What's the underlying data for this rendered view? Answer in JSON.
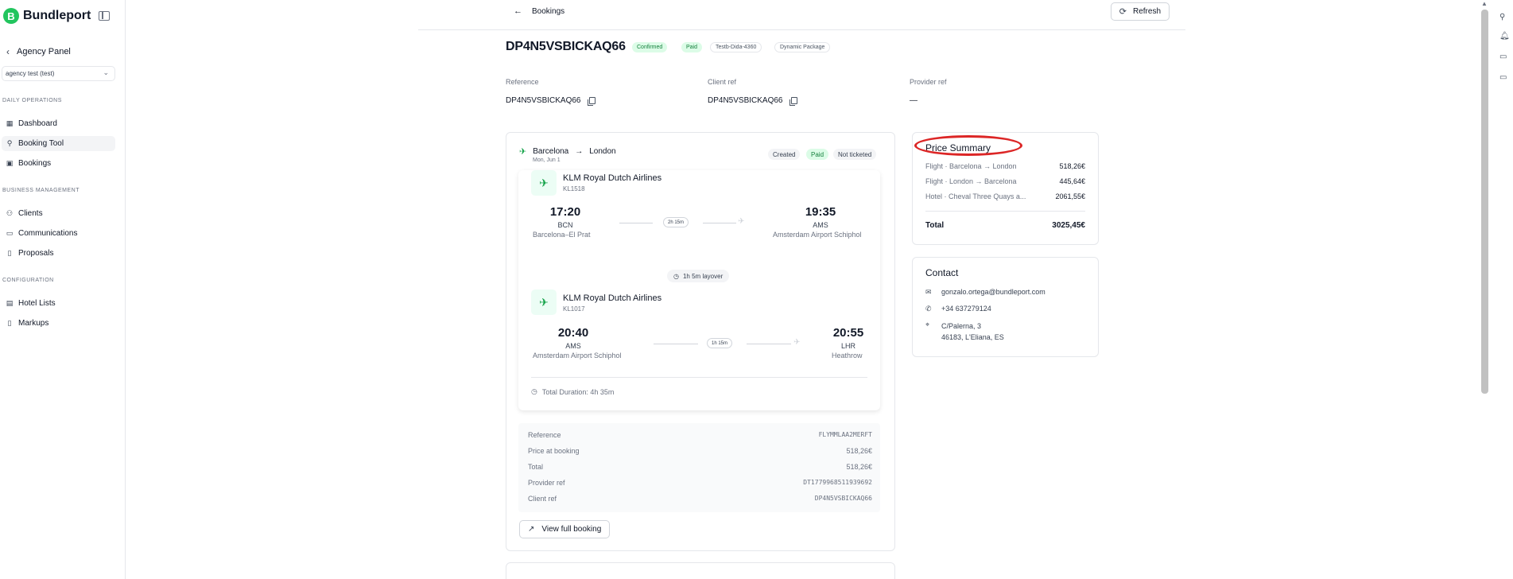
{
  "brand": {
    "logo_letter": "B",
    "name": "Bundleport"
  },
  "sidebar": {
    "back_label": "Agency Panel",
    "agency_select": "agency test (test)",
    "sections": [
      {
        "title": "DAILY OPERATIONS",
        "items": [
          {
            "label": "Dashboard",
            "icon": "grid-icon"
          },
          {
            "label": "Booking Tool",
            "icon": "search-icon",
            "active": true
          },
          {
            "label": "Bookings",
            "icon": "calendar-icon"
          }
        ]
      },
      {
        "title": "BUSINESS MANAGEMENT",
        "items": [
          {
            "label": "Clients",
            "icon": "users-icon"
          },
          {
            "label": "Communications",
            "icon": "message-icon"
          },
          {
            "label": "Proposals",
            "icon": "document-icon"
          }
        ]
      },
      {
        "title": "CONFIGURATION",
        "items": [
          {
            "label": "Hotel Lists",
            "icon": "list-icon"
          },
          {
            "label": "Markups",
            "icon": "document-icon"
          }
        ]
      }
    ]
  },
  "topbar": {
    "back_label": "Bookings",
    "refresh_label": "Refresh"
  },
  "booking": {
    "id": "DP4N5VSBICKAQ66",
    "badges": [
      "Confirmed",
      "Paid",
      "Testb-Dida-4360",
      "Dynamic Package"
    ],
    "reference_label": "Reference",
    "reference": "DP4N5VSBICKAQ66",
    "client_ref_label": "Client ref",
    "client_ref": "DP4N5VSBICKAQ66",
    "provider_ref_label": "Provider ref",
    "provider_ref": "—"
  },
  "flight": {
    "from": "Barcelona",
    "to": "London",
    "date": "Mon, Jun 1",
    "statuses": [
      "Created",
      "Paid",
      "Not ticketed"
    ],
    "segments": [
      {
        "airline": "KLM Royal Dutch Airlines",
        "flight_no": "KL1518",
        "dep_time": "17:20",
        "dep_iata": "BCN",
        "dep_airport": "Barcelona–El Prat",
        "duration": "2h 15m",
        "arr_time": "19:35",
        "arr_iata": "AMS",
        "arr_airport": "Amsterdam Airport Schiphol"
      },
      {
        "airline": "KLM Royal Dutch Airlines",
        "flight_no": "KL1017",
        "dep_time": "20:40",
        "dep_iata": "AMS",
        "dep_airport": "Amsterdam Airport Schiphol",
        "duration": "1h 15m",
        "arr_time": "20:55",
        "arr_iata": "LHR",
        "arr_airport": "Heathrow"
      }
    ],
    "layover": "1h 5m layover",
    "total_duration": "Total Duration: 4h 35m",
    "details": [
      {
        "key": "Reference",
        "value": "FLYMMLAA2MERFT",
        "mono": true
      },
      {
        "key": "Price at booking",
        "value": "518,26€"
      },
      {
        "key": "Total",
        "value": "518,26€"
      },
      {
        "key": "Provider ref",
        "value": "DT1779968511939692",
        "mono": true
      },
      {
        "key": "Client ref",
        "value": "DP4N5VSBICKAQ66",
        "mono": true
      }
    ],
    "view_full_label": "View full booking"
  },
  "price_summary": {
    "title": "Price Summary",
    "rows": [
      {
        "label": "Flight · Barcelona → London",
        "value": "518,26€"
      },
      {
        "label": "Flight · London → Barcelona",
        "value": "445,64€"
      },
      {
        "label": "Hotel · Cheval Three Quays a...",
        "value": "2061,55€"
      }
    ],
    "total_label": "Total",
    "total_value": "3025,45€"
  },
  "contact": {
    "title": "Contact",
    "email": "gonzalo.ortega@bundleport.com",
    "phone": "+34 637279124",
    "address_line1": "C/Palerna, 3",
    "address_line2": "46183, L'Eliana, ES"
  },
  "colors": {
    "accent_green": "#22c55e",
    "highlight_red": "#dc2626"
  }
}
